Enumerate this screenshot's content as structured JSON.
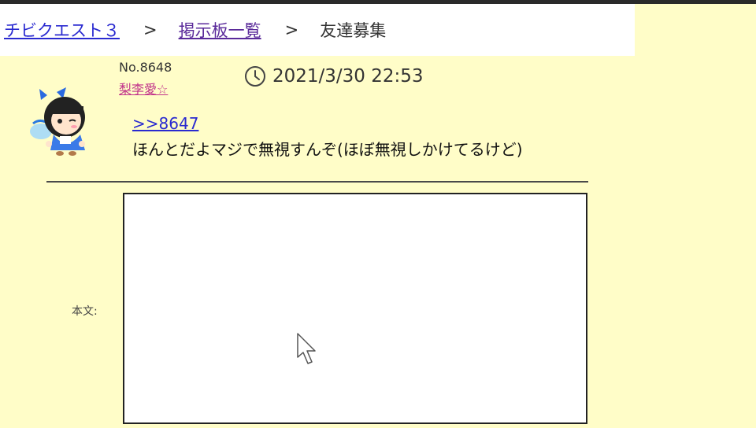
{
  "breadcrumb": {
    "items": [
      {
        "label": "チビクエスト３"
      },
      {
        "label": "掲示板一覧"
      },
      {
        "label": "友達募集"
      }
    ],
    "separator": ">"
  },
  "post": {
    "number": "No.8648",
    "author": "梨李愛☆",
    "timestamp": "2021/3/30 22:53",
    "reply_to": ">>8647",
    "body": "ほんとだよマジで無視すんぞ(ほぼ無視しかけてるけど)"
  },
  "form": {
    "body_label": "本文:",
    "body_value": ""
  },
  "icons": {
    "clock": "clock-icon",
    "cursor": "mouse-cursor-icon",
    "avatar": "chibi-avatar"
  },
  "colors": {
    "page_bg": "#fffdc8",
    "link": "#2a2ad0",
    "visited_link": "#5a2a9a",
    "author": "#c0308a"
  }
}
